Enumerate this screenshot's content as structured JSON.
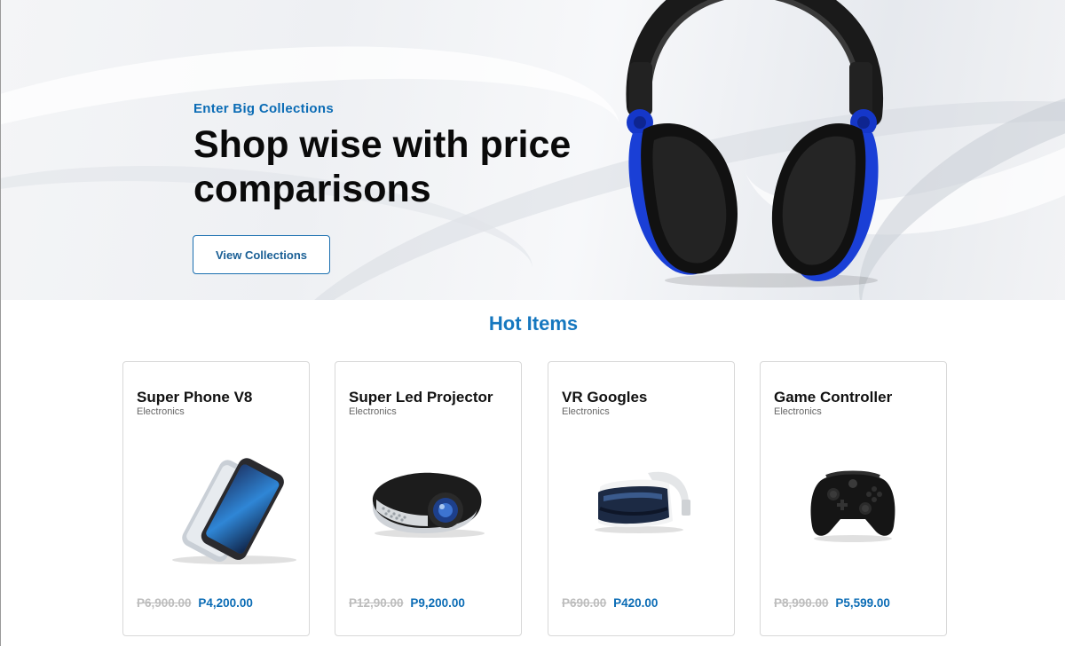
{
  "hero": {
    "eyebrow": "Enter Big Collections",
    "headline": "Shop wise with price comparisons",
    "cta_label": "View Collections"
  },
  "hot_items": {
    "title": "Hot Items",
    "products": [
      {
        "name": "Super Phone V8",
        "category": "Electronics",
        "old_price": "P6,900.00",
        "price": "P4,200.00",
        "icon": "smartphone-icon"
      },
      {
        "name": "Super Led Projector",
        "category": "Electronics",
        "old_price": "P12,90.00",
        "price": "P9,200.00",
        "icon": "projector-icon"
      },
      {
        "name": "VR Googles",
        "category": "Electronics",
        "old_price": "P690.00",
        "price": "P420.00",
        "icon": "vr-headset-icon"
      },
      {
        "name": "Game Controller",
        "category": "Electronics",
        "old_price": "P8,990.00",
        "price": "P5,599.00",
        "icon": "gamepad-icon"
      }
    ]
  },
  "colors": {
    "accent": "#0b6cb5",
    "heading": "#1577bf",
    "headphone_accent": "#1537c9"
  }
}
